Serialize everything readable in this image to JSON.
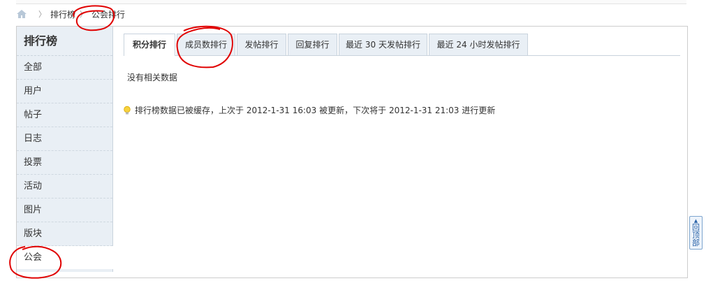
{
  "breadcrumb": {
    "home_icon": "home-icon",
    "items": [
      "排行榜",
      "公会排行"
    ]
  },
  "sidebar": {
    "title": "排行榜",
    "items": [
      {
        "label": "全部"
      },
      {
        "label": "用户"
      },
      {
        "label": "帖子"
      },
      {
        "label": "日志"
      },
      {
        "label": "投票"
      },
      {
        "label": "活动"
      },
      {
        "label": "图片"
      },
      {
        "label": "版块"
      },
      {
        "label": "公会",
        "active": true
      }
    ]
  },
  "tabs": [
    {
      "label": "积分排行",
      "active": true
    },
    {
      "label": "成员数排行"
    },
    {
      "label": "发帖排行"
    },
    {
      "label": "回复排行"
    },
    {
      "label": "最近 30 天发帖排行"
    },
    {
      "label": "最近 24 小时发帖排行"
    }
  ],
  "content": {
    "no_data": "没有相关数据",
    "notice": "排行榜数据已被缓存，上次于 2012-1-31 16:03 被更新，下次将于 2012-1-31 21:03 进行更新"
  },
  "back_to_top": "回顶部",
  "colors": {
    "sidebar_bg": "#e9eff5",
    "border": "#c9d3dd",
    "annotation": "#e00000"
  }
}
